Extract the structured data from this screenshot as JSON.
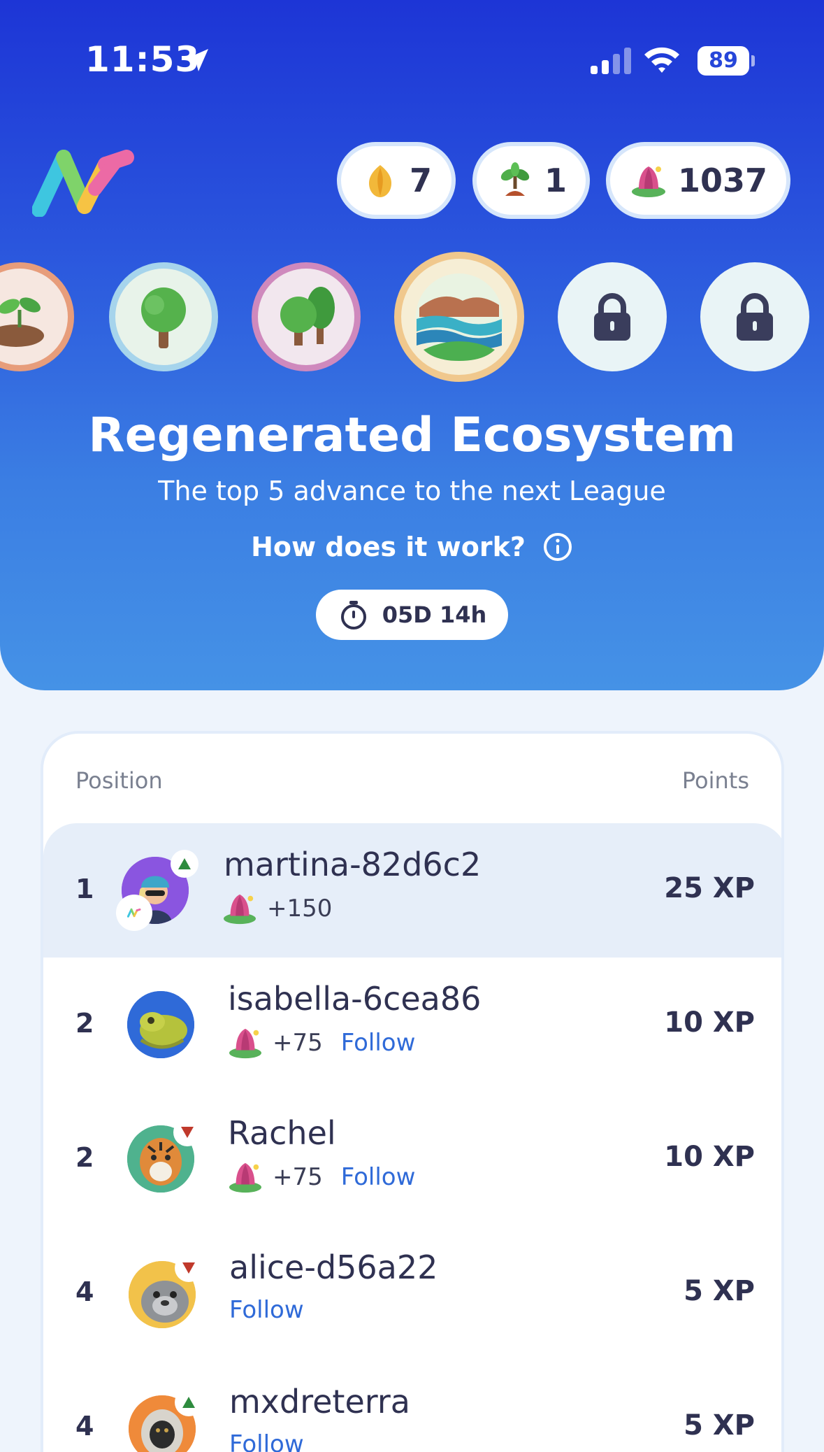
{
  "status_bar": {
    "time": "11:53",
    "battery": "89"
  },
  "currencies": [
    {
      "icon": "tulip-icon",
      "value": "7"
    },
    {
      "icon": "sprout-icon",
      "value": "1"
    },
    {
      "icon": "lotus-icon",
      "value": "1037"
    }
  ],
  "league": {
    "title": "Regenerated Ecosystem",
    "subtitle": "The top 5 advance to the next League",
    "how_label": "How does it work?",
    "timer": "05D 14h",
    "badges": [
      "seedling-badge",
      "tree-badge",
      "forest-badge",
      "ecosystem-badge",
      "locked-badge",
      "locked-badge"
    ]
  },
  "leaderboard": {
    "header_position": "Position",
    "header_points": "Points",
    "rows": [
      {
        "rank": "1",
        "name": "martina-82d6c2",
        "reward": "+150",
        "follow": "",
        "xp": "25 XP",
        "trend": "up",
        "highlight": true
      },
      {
        "rank": "2",
        "name": "isabella-6cea86",
        "reward": "+75",
        "follow": "Follow",
        "xp": "10 XP",
        "trend": "none"
      },
      {
        "rank": "2",
        "name": "Rachel",
        "reward": "+75",
        "follow": "Follow",
        "xp": "10 XP",
        "trend": "down"
      },
      {
        "rank": "4",
        "name": "alice-d56a22",
        "reward": "",
        "follow": "Follow",
        "xp": "5 XP",
        "trend": "down"
      },
      {
        "rank": "4",
        "name": "mxdreterra",
        "reward": "",
        "follow": "Follow",
        "xp": "5 XP",
        "trend": "up"
      }
    ]
  },
  "colors": {
    "accent": "#2f6ad8",
    "hero_top": "#1d35d6",
    "hero_bottom": "#4592e6",
    "up": "#2e8b3e",
    "down": "#c0392b"
  }
}
